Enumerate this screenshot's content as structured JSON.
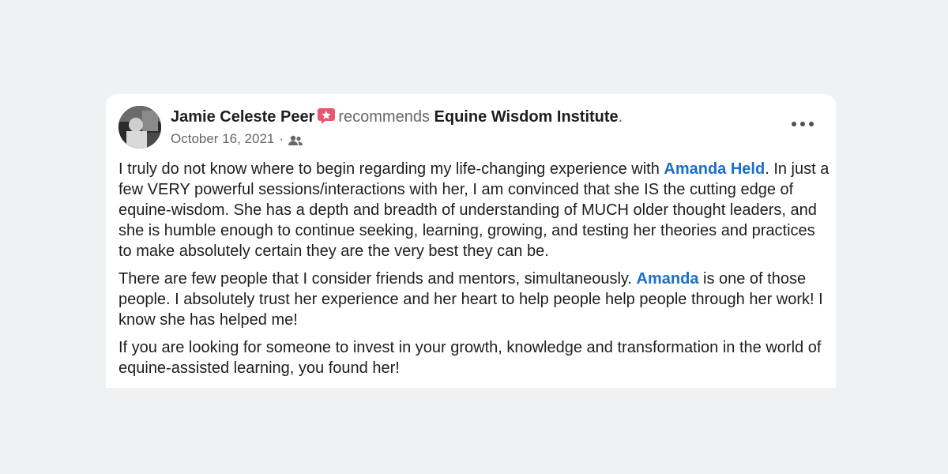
{
  "post": {
    "author": "Jamie Celeste Peer",
    "action": "recommends",
    "page_name": "Equine Wisdom Institute",
    "period": ".",
    "date": "October 16, 2021",
    "date_sep": "·",
    "audience_icon": "friends-icon",
    "badge_icon": "recommendation-star-icon",
    "more_icon": "more-options-icon",
    "paragraphs": {
      "p1_a": "I truly do not know where to begin regarding my life-changing experience with ",
      "p1_mention": "Amanda Held",
      "p1_b": ". In just a few VERY powerful sessions/interactions with her, I am convinced that she IS the cutting edge of equine-wisdom.  She has a depth and breadth of understanding of MUCH older thought leaders, and she is humble enough to continue seeking, learning, growing, and testing her theories and practices to make absolutely certain they are the very best they can be.",
      "p2_a": "There are few people that I consider friends and mentors, simultaneously.  ",
      "p2_mention": "Amanda",
      "p2_b": " is one of those people.  I absolutely trust her experience and her heart to help people help people through her work!  I know she has helped me!",
      "p3": "If you are looking for someone to invest in your growth, knowledge and transformation in the world of equine-assisted learning, you found her!"
    }
  },
  "colors": {
    "background": "#f0f1f3",
    "card": "#ffffff",
    "mention": "#1a6fc9",
    "muted": "#65676b",
    "badge": "#e8576f"
  }
}
